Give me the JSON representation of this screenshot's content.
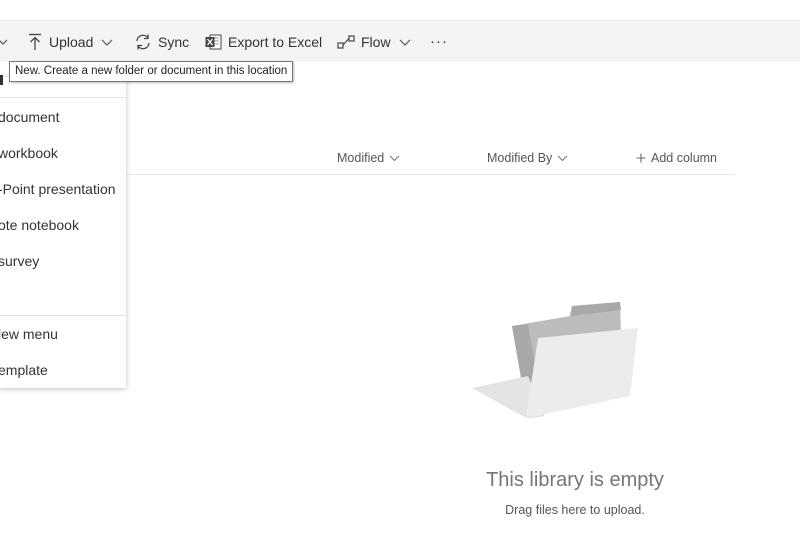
{
  "toolbar": {
    "upload_label": "Upload",
    "sync_label": "Sync",
    "export_label": "Export to Excel",
    "flow_label": "Flow",
    "more_label": "···"
  },
  "tooltip": {
    "text": "New. Create a new folder or document in this location"
  },
  "new_menu": {
    "items": [
      {
        "label": "document"
      },
      {
        "label": "workbook"
      },
      {
        "label": "-Point presentation"
      },
      {
        "label": "ote notebook"
      },
      {
        "label": "survey"
      },
      {
        "label": "lew menu"
      },
      {
        "label": "emplate"
      }
    ]
  },
  "columns": {
    "modified": "Modified",
    "modified_by": "Modified By",
    "add_column": "Add column"
  },
  "empty_state": {
    "title": "This library is empty",
    "subtitle": "Drag files here to upload."
  },
  "colors": {
    "commandbar_bg": "#f4f4f4",
    "excel_green": "#217346",
    "folder_dark": "#bdbdbd",
    "folder_light": "#e6e6e6"
  }
}
